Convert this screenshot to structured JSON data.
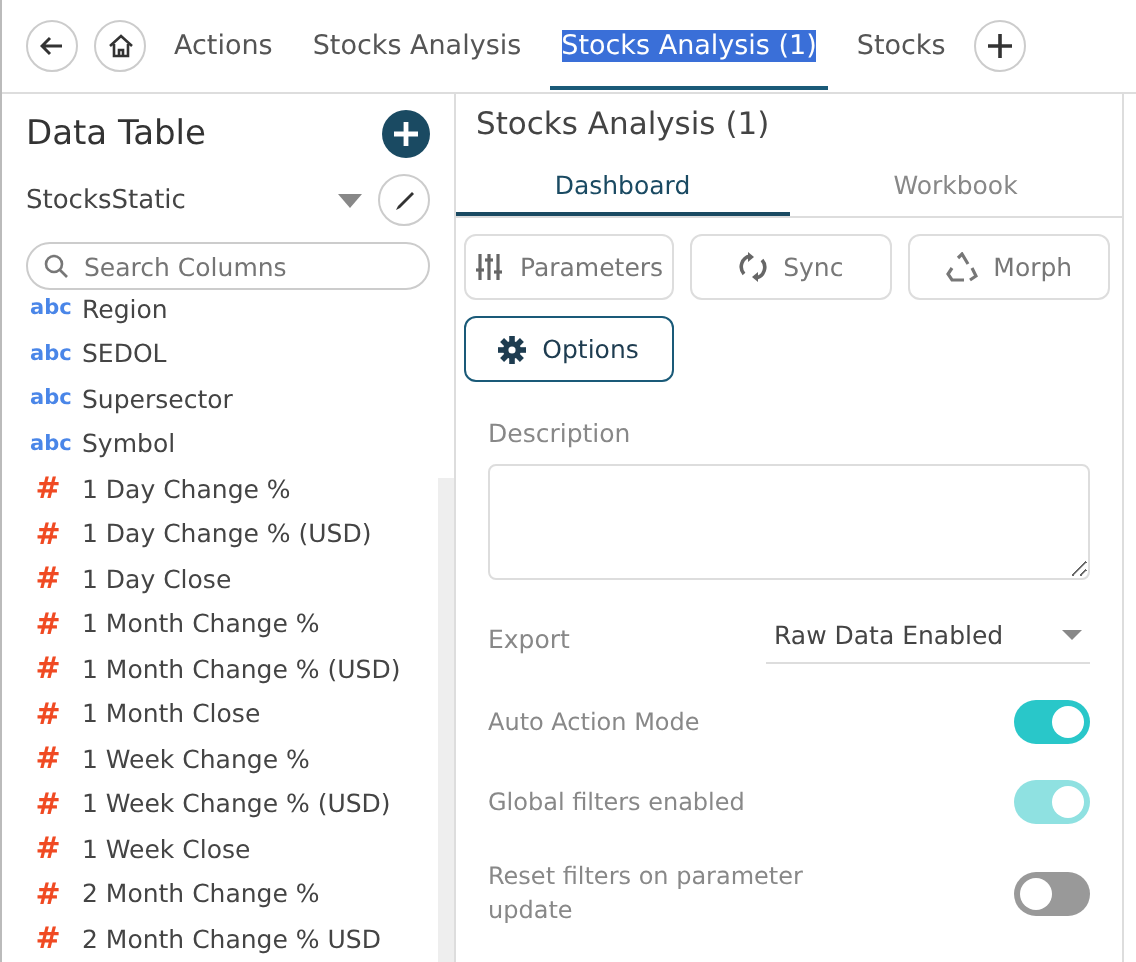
{
  "tabs": [
    {
      "label": "Actions",
      "selected": false
    },
    {
      "label": "Stocks Analysis",
      "selected": false
    },
    {
      "label": "Stocks Analysis (1)",
      "selected": true
    },
    {
      "label": "Stocks",
      "selected": false
    }
  ],
  "data_table": {
    "title": "Data Table",
    "source": "StocksStatic",
    "search": {
      "placeholder": "Search Columns"
    },
    "columns": [
      {
        "kind": "text",
        "type_label": "abc",
        "name": "Region"
      },
      {
        "kind": "text",
        "type_label": "abc",
        "name": "SEDOL"
      },
      {
        "kind": "text",
        "type_label": "abc",
        "name": "Supersector"
      },
      {
        "kind": "text",
        "type_label": "abc",
        "name": "Symbol"
      },
      {
        "kind": "number",
        "type_label": "#",
        "name": "1 Day Change %"
      },
      {
        "kind": "number",
        "type_label": "#",
        "name": "1 Day Change % (USD)"
      },
      {
        "kind": "number",
        "type_label": "#",
        "name": "1 Day Close"
      },
      {
        "kind": "number",
        "type_label": "#",
        "name": "1 Month Change %"
      },
      {
        "kind": "number",
        "type_label": "#",
        "name": "1 Month Change % (USD)"
      },
      {
        "kind": "number",
        "type_label": "#",
        "name": "1 Month Close"
      },
      {
        "kind": "number",
        "type_label": "#",
        "name": "1 Week Change %"
      },
      {
        "kind": "number",
        "type_label": "#",
        "name": "1 Week Change % (USD)"
      },
      {
        "kind": "number",
        "type_label": "#",
        "name": "1 Week Close"
      },
      {
        "kind": "number",
        "type_label": "#",
        "name": "2 Month Change %"
      },
      {
        "kind": "number",
        "type_label": "#",
        "name": "2 Month Change % USD"
      }
    ]
  },
  "panel": {
    "title": "Stocks Analysis (1)",
    "tabs": [
      {
        "label": "Dashboard",
        "selected": true
      },
      {
        "label": "Workbook",
        "selected": false
      }
    ],
    "buttons": [
      {
        "kind": "parameters",
        "label": "Parameters",
        "selected": false
      },
      {
        "kind": "sync",
        "label": "Sync",
        "selected": false
      },
      {
        "kind": "morph",
        "label": "Morph",
        "selected": false
      },
      {
        "kind": "options",
        "label": "Options",
        "selected": true
      }
    ],
    "description": {
      "label": "Description"
    },
    "export": {
      "label": "Export",
      "value": "Raw Data Enabled"
    },
    "toggles": [
      {
        "label": "Auto Action Mode",
        "on": true,
        "disabled": false
      },
      {
        "label": "Global filters enabled",
        "on": true,
        "disabled": true
      },
      {
        "label": "Reset filters on parameter update",
        "on": false,
        "disabled": false
      }
    ]
  }
}
